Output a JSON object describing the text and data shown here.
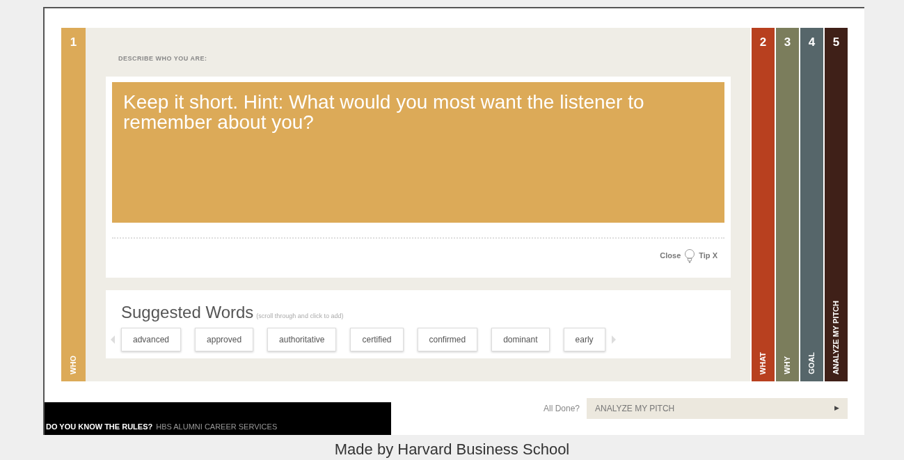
{
  "steps": [
    {
      "number": "1",
      "label": "WHO",
      "color": "#dcaa58",
      "selected": true
    },
    {
      "number": "2",
      "label": "WHAT",
      "color": "#b8401f",
      "selected": false
    },
    {
      "number": "3",
      "label": "WHY",
      "color": "#7b7d5c",
      "selected": false
    },
    {
      "number": "4",
      "label": "GOAL",
      "color": "#56666a",
      "selected": false
    },
    {
      "number": "5",
      "label": "ANALYZE MY PITCH",
      "color": "#3f2018",
      "selected": false
    }
  ],
  "panel": {
    "prompt": "DESCRIBE WHO YOU ARE:",
    "answer": {
      "placeholder": "Keep it short. Hint: What would you most want the listener to remember about you?"
    },
    "tip_close": "Close",
    "tip_label": "Tip X"
  },
  "suggested": {
    "title": "Suggested Words",
    "note": "(scroll through and click to add)",
    "words": [
      "advanced",
      "approved",
      "authoritative",
      "certified",
      "confirmed",
      "dominant",
      "early"
    ]
  },
  "footer": {
    "banner_lead": "DO YOU KNOW THE RULES?",
    "banner_rest": "HBS ALUMNI CAREER SERVICES",
    "done_label": "All Done?",
    "done_button": "ANALYZE MY PITCH",
    "done_arrow": "▶"
  },
  "caption": "Made by Harvard Business School"
}
